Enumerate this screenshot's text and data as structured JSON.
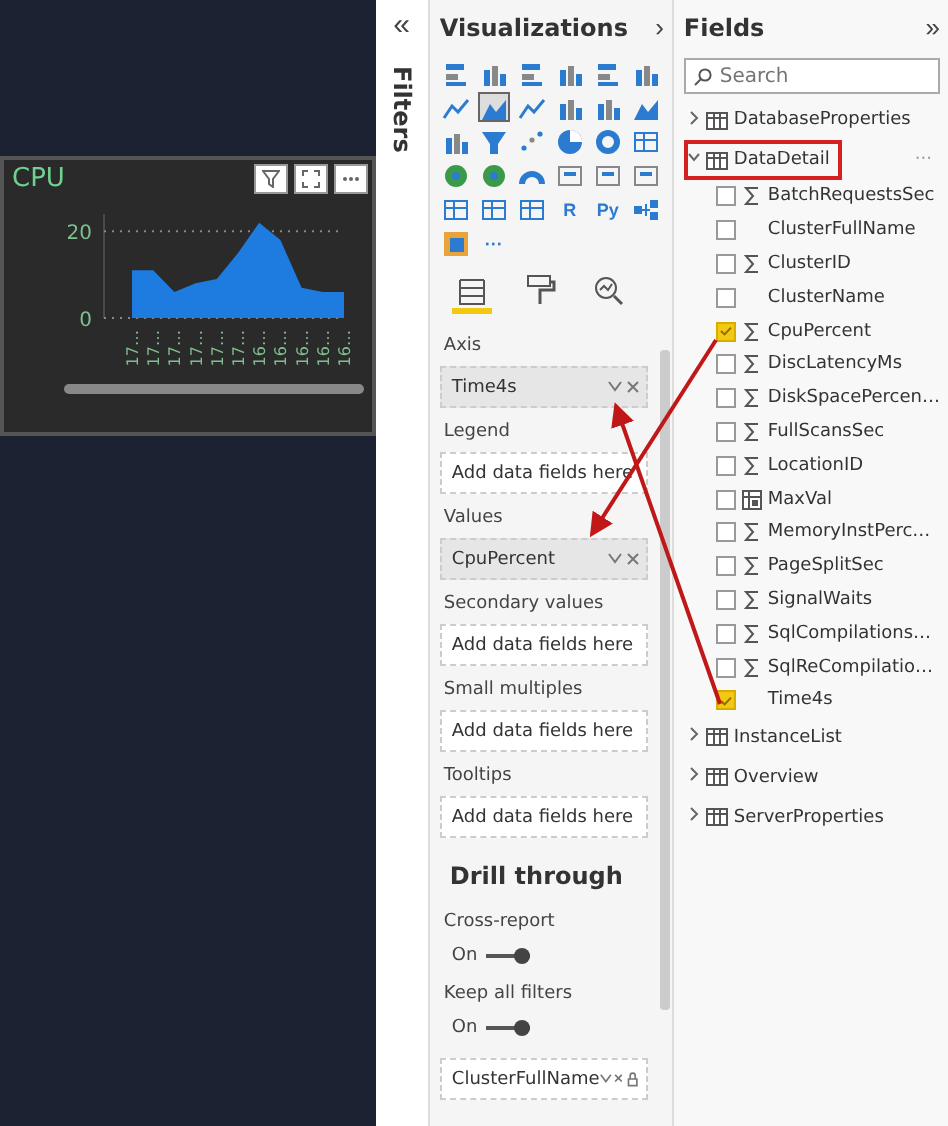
{
  "filters_strip": {
    "collapse": "«",
    "label": "Filters"
  },
  "visual": {
    "title": "CPU",
    "chart_data": {
      "type": "area",
      "categories": [
        "17…",
        "17…",
        "17…",
        "17…",
        "17…",
        "17…",
        "16…",
        "16…",
        "16…",
        "16…",
        "16…"
      ],
      "series": [
        {
          "color": "#1e7be0",
          "values": [
            11,
            11,
            6,
            8,
            9,
            15,
            22,
            18,
            7,
            6,
            6
          ]
        }
      ],
      "ylim": [
        0,
        24
      ],
      "yticks": [
        0,
        20
      ]
    }
  },
  "visualizations": {
    "title": "Visualizations",
    "expand": "›",
    "gallery": [
      {
        "kind": "bar",
        "selected": false
      },
      {
        "kind": "column",
        "selected": false
      },
      {
        "kind": "bar",
        "selected": false
      },
      {
        "kind": "column",
        "selected": false
      },
      {
        "kind": "bar",
        "selected": false
      },
      {
        "kind": "column",
        "selected": false
      },
      {
        "kind": "line",
        "selected": false
      },
      {
        "kind": "area",
        "selected": true
      },
      {
        "kind": "line",
        "selected": false
      },
      {
        "kind": "column",
        "selected": false
      },
      {
        "kind": "column",
        "selected": false
      },
      {
        "kind": "area",
        "selected": false
      },
      {
        "kind": "column",
        "selected": false
      },
      {
        "kind": "funnel",
        "selected": false
      },
      {
        "kind": "scatter",
        "selected": false
      },
      {
        "kind": "pie",
        "selected": false
      },
      {
        "kind": "donut",
        "selected": false
      },
      {
        "kind": "table",
        "selected": false
      },
      {
        "kind": "map",
        "selected": false
      },
      {
        "kind": "map",
        "selected": false
      },
      {
        "kind": "gauge",
        "selected": false
      },
      {
        "kind": "card",
        "selected": false
      },
      {
        "kind": "card",
        "selected": false
      },
      {
        "kind": "card",
        "selected": false
      },
      {
        "kind": "table",
        "selected": false
      },
      {
        "kind": "table",
        "selected": false
      },
      {
        "kind": "table",
        "selected": false
      },
      {
        "kind": "text",
        "label": "R",
        "selected": false
      },
      {
        "kind": "text",
        "label": "Py",
        "selected": false
      },
      {
        "kind": "tree",
        "selected": false
      },
      {
        "kind": "custom",
        "selected": false
      },
      {
        "kind": "text",
        "label": "···",
        "selected": false
      }
    ],
    "tabs": [
      {
        "kind": "fields",
        "selected": true
      },
      {
        "kind": "format",
        "selected": false
      },
      {
        "kind": "analytics",
        "selected": false
      }
    ],
    "wells": [
      {
        "label": "Axis",
        "value": "Time4s"
      },
      {
        "label": "Legend",
        "placeholder": "Add data fields here"
      },
      {
        "label": "Values",
        "value": "CpuPercent"
      },
      {
        "label": "Secondary values",
        "placeholder": "Add data fields here"
      },
      {
        "label": "Small multiples",
        "placeholder": "Add data fields here"
      },
      {
        "label": "Tooltips",
        "placeholder": "Add data fields here"
      }
    ],
    "drill_through": {
      "title": "Drill through",
      "toggles": [
        {
          "label": "Cross-report",
          "state": "On",
          "on": true
        },
        {
          "label": "Keep all filters",
          "state": "On",
          "on": true
        }
      ],
      "field": "ClusterFullName"
    }
  },
  "fields": {
    "title": "Fields",
    "collapse": "»",
    "search": {
      "placeholder": "Search"
    },
    "tables": [
      {
        "name": "DatabaseProperties",
        "expanded": false,
        "highlighted": false
      },
      {
        "name": "DataDetail",
        "expanded": true,
        "highlighted": true,
        "more": "···",
        "children": [
          {
            "name": "BatchRequestsSec",
            "kind": "sum",
            "checked": false
          },
          {
            "name": "ClusterFullName",
            "kind": "plain",
            "checked": false
          },
          {
            "name": "ClusterID",
            "kind": "sum",
            "checked": false
          },
          {
            "name": "ClusterName",
            "kind": "plain",
            "checked": false
          },
          {
            "name": "CpuPercent",
            "kind": "sum",
            "checked": true
          },
          {
            "name": "DiscLatencyMs",
            "kind": "sum",
            "checked": false
          },
          {
            "name": "DiskSpacePercen…",
            "kind": "sum",
            "checked": false
          },
          {
            "name": "FullScansSec",
            "kind": "sum",
            "checked": false
          },
          {
            "name": "LocationID",
            "kind": "sum",
            "checked": false
          },
          {
            "name": "MaxVal",
            "kind": "calc",
            "checked": false
          },
          {
            "name": "MemoryInstPerc…",
            "kind": "sum",
            "checked": false
          },
          {
            "name": "PageSplitSec",
            "kind": "sum",
            "checked": false
          },
          {
            "name": "SignalWaits",
            "kind": "sum",
            "checked": false
          },
          {
            "name": "SqlCompilations…",
            "kind": "sum",
            "checked": false
          },
          {
            "name": "SqlReCompilatio…",
            "kind": "sum",
            "checked": false
          },
          {
            "name": "Time4s",
            "kind": "plain",
            "checked": true
          }
        ]
      },
      {
        "name": "InstanceList",
        "expanded": false,
        "highlighted": false
      },
      {
        "name": "Overview",
        "expanded": false,
        "highlighted": false
      },
      {
        "name": "ServerProperties",
        "expanded": false,
        "highlighted": false
      }
    ]
  }
}
